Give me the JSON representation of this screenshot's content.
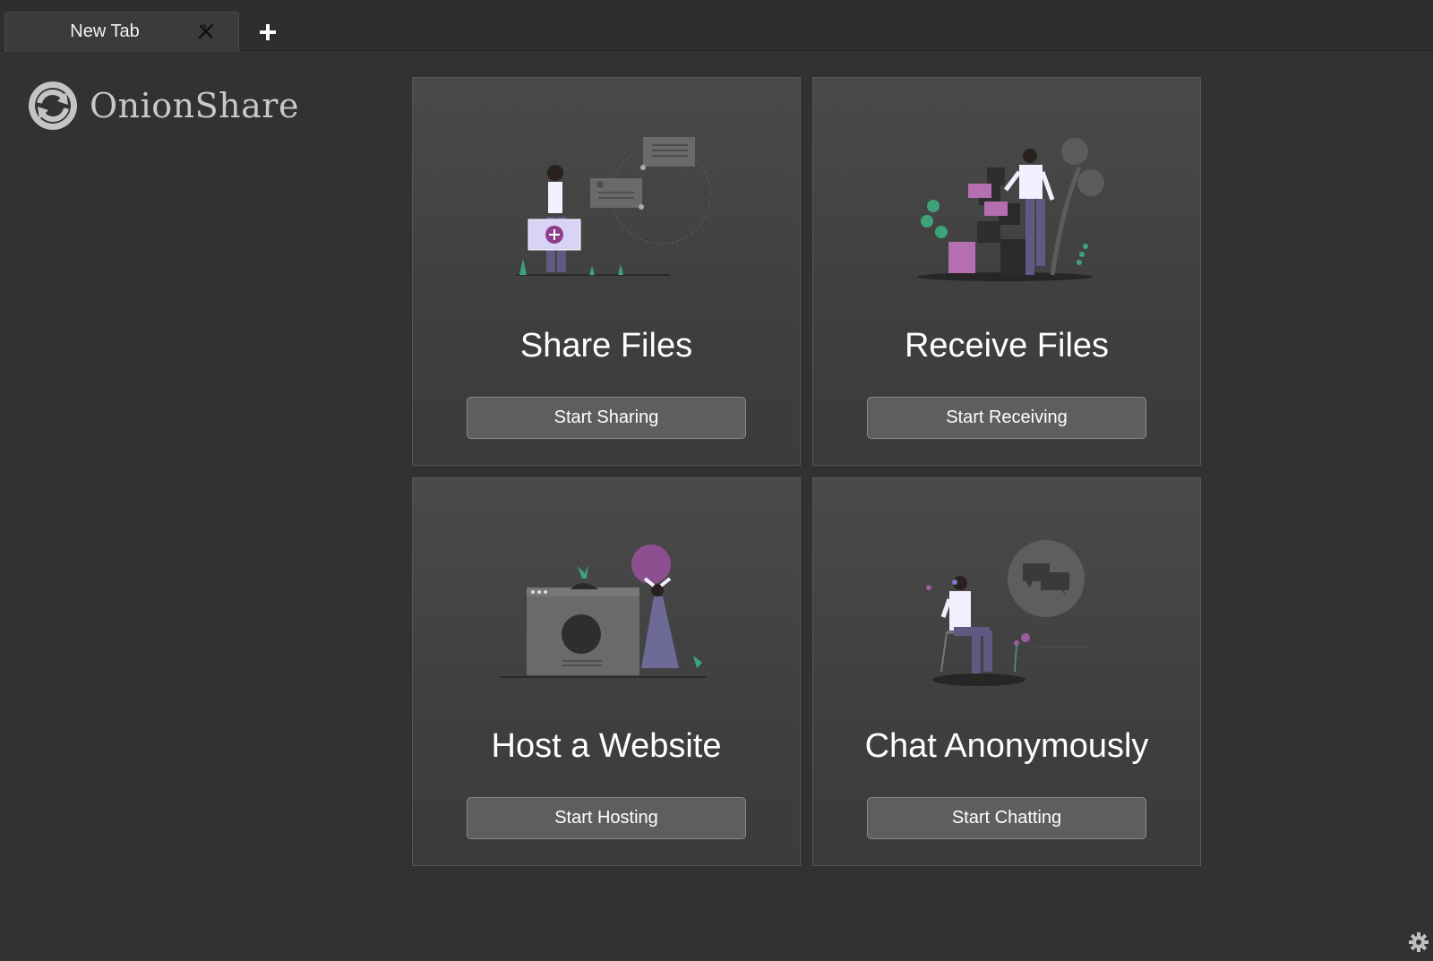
{
  "tabs": [
    {
      "label": "New Tab"
    }
  ],
  "app": {
    "name": "OnionShare"
  },
  "modes": {
    "share": {
      "title": "Share Files",
      "button": "Start Sharing"
    },
    "receive": {
      "title": "Receive Files",
      "button": "Start Receiving"
    },
    "website": {
      "title": "Host a Website",
      "button": "Start Hosting"
    },
    "chat": {
      "title": "Chat Anonymously",
      "button": "Start Chatting"
    }
  },
  "icons": {
    "tab_close": "close-icon",
    "new_tab": "plus-icon",
    "logo": "onionshare-logo-icon",
    "settings": "gear-icon"
  },
  "colors": {
    "background": "#323232",
    "card": "#454545",
    "button": "#5e5e5e",
    "accent_purple": "#9b5c9d",
    "accent_green": "#3fa37a",
    "lavender": "#c9c2f0"
  }
}
